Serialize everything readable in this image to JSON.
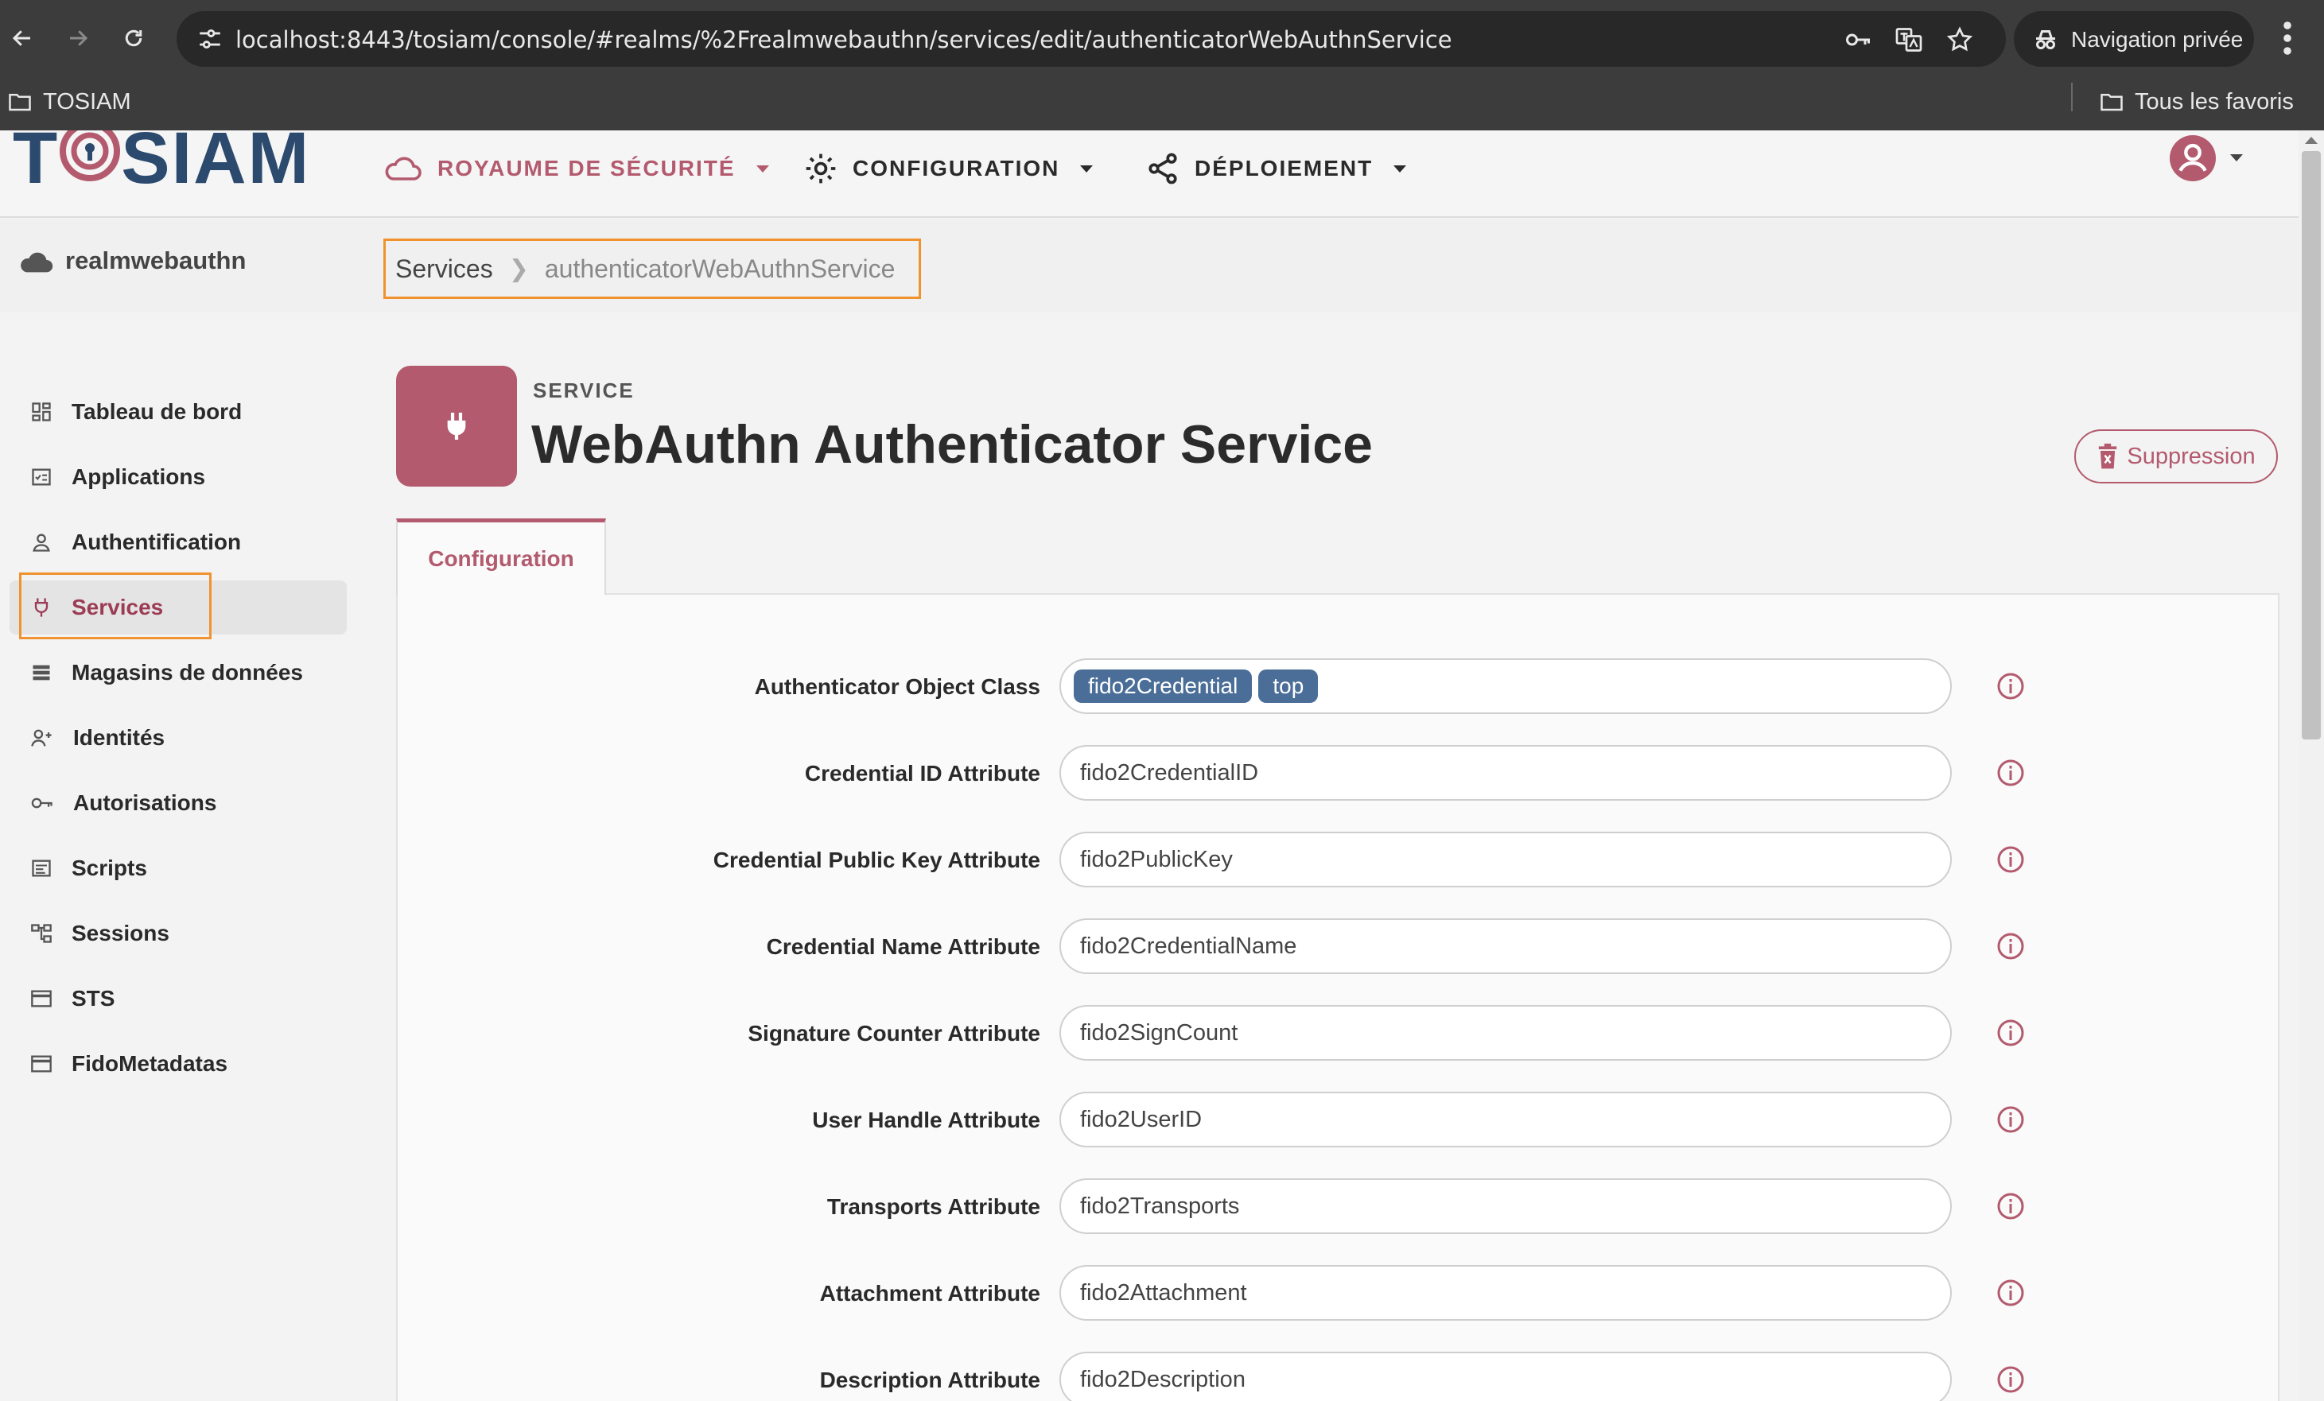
{
  "browser": {
    "url": "localhost:8443/tosiam/console/#realms/%2Frealmwebauthn/services/edit/authenticatorWebAuthnService",
    "private_label": "Navigation privée",
    "bookmark_left": "TOSIAM",
    "bookmark_right": "Tous les favoris"
  },
  "header": {
    "logo_left": "T",
    "logo_right": "SIAM",
    "menu": [
      {
        "label": "ROYAUME DE SÉCURITÉ",
        "color": "#b35a6e"
      },
      {
        "label": "CONFIGURATION",
        "color": "#2a2a2a"
      },
      {
        "label": "DÉPLOIEMENT",
        "color": "#2a2a2a"
      }
    ]
  },
  "subheader": {
    "realm": "realmwebauthn",
    "breadcrumb": [
      "Services",
      "authenticatorWebAuthnService"
    ]
  },
  "sidebar": {
    "items": [
      {
        "label": "Tableau de bord",
        "icon": "dashboard-icon"
      },
      {
        "label": "Applications",
        "icon": "applications-icon"
      },
      {
        "label": "Authentification",
        "icon": "user-icon"
      },
      {
        "label": "Services",
        "icon": "plug-icon",
        "active": true
      },
      {
        "label": "Magasins de données",
        "icon": "datastore-icon"
      },
      {
        "label": "Identités",
        "icon": "identities-icon"
      },
      {
        "label": "Autorisations",
        "icon": "key-icon"
      },
      {
        "label": "Scripts",
        "icon": "scripts-icon"
      },
      {
        "label": "Sessions",
        "icon": "sessions-icon"
      },
      {
        "label": "STS",
        "icon": "card-icon"
      },
      {
        "label": "FidoMetadatas",
        "icon": "card-icon"
      }
    ]
  },
  "service": {
    "kicker": "SERVICE",
    "title": "WebAuthn Authenticator Service",
    "delete_label": "Suppression",
    "tab_label": "Configuration"
  },
  "form": {
    "object_class_label": "Authenticator Object Class",
    "object_class_chips": [
      "fido2Credential",
      "top"
    ],
    "fields": [
      {
        "label": "Credential ID Attribute",
        "value": "fido2CredentialID"
      },
      {
        "label": "Credential Public Key Attribute",
        "value": "fido2PublicKey"
      },
      {
        "label": "Credential Name Attribute",
        "value": "fido2CredentialName"
      },
      {
        "label": "Signature Counter Attribute",
        "value": "fido2SignCount"
      },
      {
        "label": "User Handle Attribute",
        "value": "fido2UserID"
      },
      {
        "label": "Transports Attribute",
        "value": "fido2Transports"
      },
      {
        "label": "Attachment Attribute",
        "value": "fido2Attachment"
      },
      {
        "label": "Description Attribute",
        "value": "fido2Description"
      }
    ]
  },
  "colors": {
    "accent": "#b35a6e",
    "chip": "#4a6e98",
    "highlight": "#f0922e"
  }
}
